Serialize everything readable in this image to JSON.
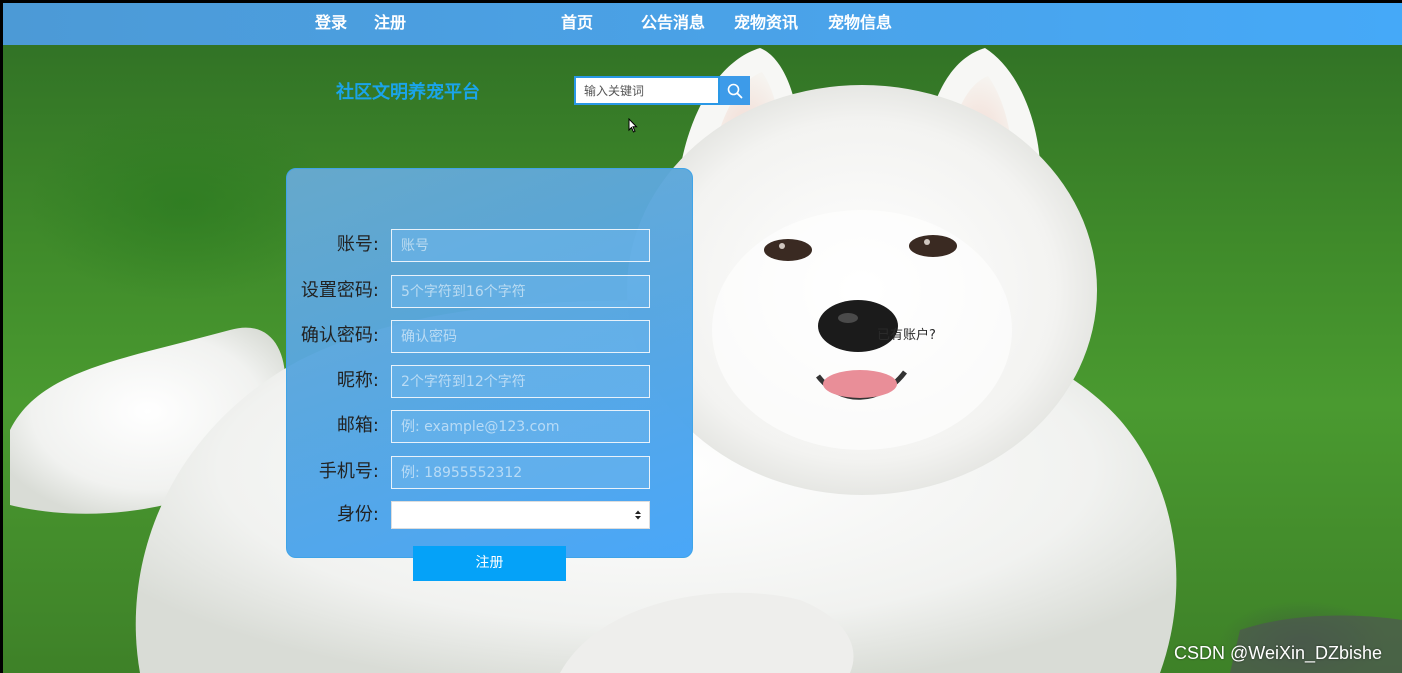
{
  "nav": {
    "login": "登录",
    "register": "注册",
    "home": "首页",
    "announcements": "公告消息",
    "pet_news": "宠物资讯",
    "pet_info": "宠物信息"
  },
  "brand": {
    "title": "社区文明养宠平台"
  },
  "search": {
    "placeholder": "输入关键词",
    "icon": "search-icon"
  },
  "form": {
    "account": {
      "label": "账号:",
      "placeholder": "账号"
    },
    "password": {
      "label": "设置密码:",
      "placeholder": "5个字符到16个字符"
    },
    "confirm": {
      "label": "确认密码:",
      "placeholder": "确认密码"
    },
    "nickname": {
      "label": "昵称:",
      "placeholder": "2个字符到12个字符"
    },
    "email": {
      "label": "邮箱:",
      "placeholder": "例: example@123.com"
    },
    "phone": {
      "label": "手机号:",
      "placeholder": "例: 18955552312"
    },
    "role": {
      "label": "身份:",
      "value": ""
    },
    "submit": "注册"
  },
  "login_prompt": "已有账户?",
  "watermark": "CSDN @WeiXin_DZbishe",
  "colors": {
    "nav_bg": "#4aa3ea",
    "brand": "#1aa4ea",
    "panel": "#54a5e1",
    "button": "#05a2f8"
  }
}
